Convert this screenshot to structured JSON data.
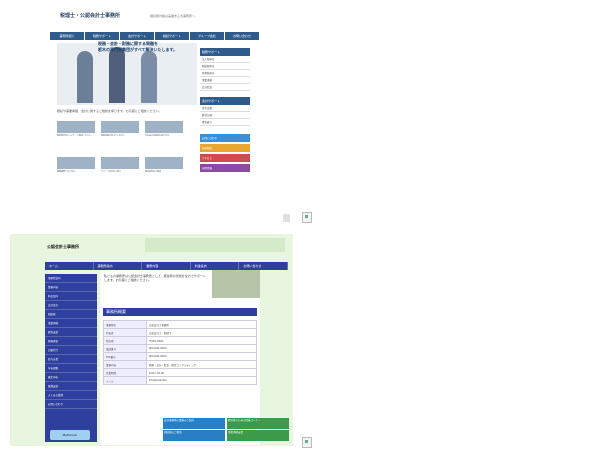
{
  "site1": {
    "title": "税理士・公認会計士事務所",
    "subtitle": "相続税対策は実績ある当事務所へ",
    "nav": [
      "事務所紹介",
      "税務サポート",
      "会計サポート",
      "相続サポート",
      "グループ会社",
      "お問い合わせ"
    ],
    "hero_text": "税務・会計・財務に関する問題を\n栃木の専門家集団がすべて解決いたします。",
    "intro_text": "相続や事業承継、会計に関するご相談を承ります。お気軽にご相談ください。",
    "cells": [
      {
        "text": "相続税申告について、ご相談ください。"
      },
      {
        "text": "事業承継を考えている方へ"
      },
      {
        "text": "会社設立の相談も承ります。"
      },
      {
        "text": "税務調査へのご対応"
      },
      {
        "text": "グループ会社のご紹介"
      },
      {
        "text": "経営改善のご相談"
      }
    ],
    "sidebar_heading": "税務サポート",
    "sidebar_items": [
      "法人税申告",
      "相続税申告",
      "所得税申告",
      "事業承継",
      "会計監査"
    ],
    "sidebar_heading2": "会計サポート",
    "sidebar_items2": [
      "月次決算",
      "経営計画",
      "資金繰り"
    ],
    "buttons": [
      {
        "label": "お問い合わせ",
        "color": "#3a8fd4"
      },
      {
        "label": "無料相談",
        "color": "#e8a830"
      },
      {
        "label": "アクセス",
        "color": "#d04c4c"
      },
      {
        "label": "採用情報",
        "color": "#8a4ca0"
      }
    ]
  },
  "site2": {
    "title": "公認会計士事務所",
    "nav": [
      "ホーム",
      "事務所案内",
      "業務内容",
      "料金案内",
      "お問い合わせ"
    ],
    "sidebar": [
      "事務所案内",
      "業務内容",
      "料金案内",
      "会社設立",
      "相続税",
      "事業承継",
      "経営支援",
      "税務調査",
      "記帳代行",
      "給与計算",
      "年末調整",
      "確定申告",
      "融資支援",
      "よくある質問",
      "お問い合わせ"
    ],
    "intro": "私どもの事務所は公認会計士事務所として、経営者の皆様を全力でサポートします。お気軽にご相談ください。",
    "section_heading": "事務所概要",
    "table": [
      {
        "k": "事務所名",
        "v": "公認会計士事務所"
      },
      {
        "k": "代表者",
        "v": "公認会計士・税理士"
      },
      {
        "k": "所在地",
        "v": "〒000-0000"
      },
      {
        "k": "電話番号",
        "v": "000-000-0000"
      },
      {
        "k": "FAX番号",
        "v": "000-000-0000"
      },
      {
        "k": "業務内容",
        "v": "税務・会計・監査・経営コンサルティング"
      },
      {
        "k": "営業時間",
        "v": "9:00〜18:00"
      },
      {
        "k": "メール",
        "v": "info@example"
      }
    ],
    "bottom_buttons": [
      {
        "label": "会計事務所の業務のご案内",
        "color": "#2a7fc4"
      },
      {
        "label": "経営者のための情報コーナー",
        "color": "#3c9b4a"
      },
      {
        "label": "相続税のご相談",
        "color": "#2a7fc4"
      },
      {
        "label": "事業承継支援",
        "color": "#3c9b4a"
      }
    ],
    "logo": "MyKomon"
  }
}
